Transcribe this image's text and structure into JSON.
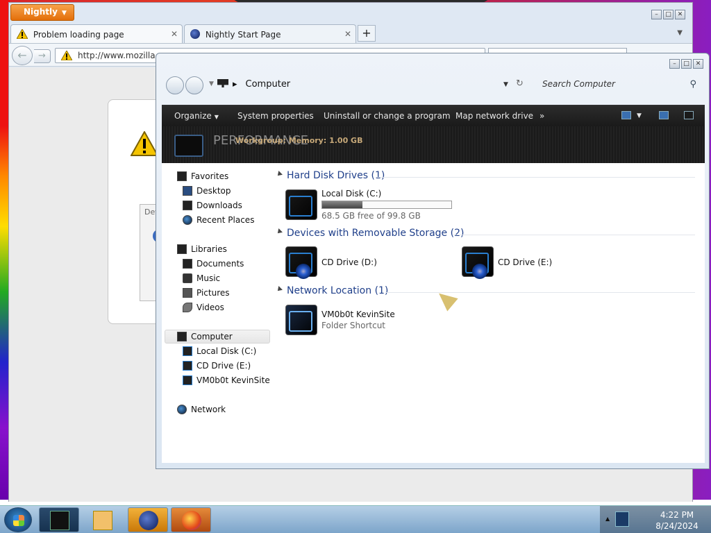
{
  "firefox": {
    "app_button": "Nightly",
    "tabs": [
      {
        "label": "Problem loading page",
        "active": true
      },
      {
        "label": "Nightly Start Page",
        "active": false
      }
    ],
    "url": "http://www.mozilla.or",
    "error_box_label": "Def"
  },
  "explorer": {
    "breadcrumb": "Computer",
    "search_placeholder": "Search Computer",
    "commands": [
      "Organize",
      "System properties",
      "Uninstall or change a program",
      "Map network drive"
    ],
    "more_label": "»",
    "performance_banner": "PERFORMANCE",
    "workgroup_overlay": "Workgroup: Memory: 1.00 GB",
    "nav": {
      "favorites": "Favorites",
      "desktop": "Desktop",
      "downloads": "Downloads",
      "recent_places": "Recent Places",
      "libraries": "Libraries",
      "documents": "Documents",
      "music": "Music",
      "pictures": "Pictures",
      "videos": "Videos",
      "computer": "Computer",
      "local_disk_c": "Local Disk (C:)",
      "cd_drive_e": "CD Drive (E:)",
      "vm0b0t": "VM0b0t KevinSite",
      "network": "Network"
    },
    "groups": {
      "hdd": {
        "label": "Hard Disk Drives (1)"
      },
      "removable": {
        "label": "Devices with Removable Storage (2)"
      },
      "network": {
        "label": "Network Location (1)"
      }
    },
    "items": {
      "local_disk": {
        "label": "Local Disk (C:)",
        "free": "68.5 GB free of 99.8 GB",
        "used_fraction": 0.31
      },
      "cd_d": {
        "label": "CD Drive (D:)"
      },
      "cd_e": {
        "label": "CD Drive (E:)"
      },
      "vm0b0t": {
        "label": "VM0b0t KevinSite",
        "sub": "Folder Shortcut"
      }
    }
  },
  "taskbar": {
    "time": "4:22 PM",
    "date": "8/24/2024"
  }
}
